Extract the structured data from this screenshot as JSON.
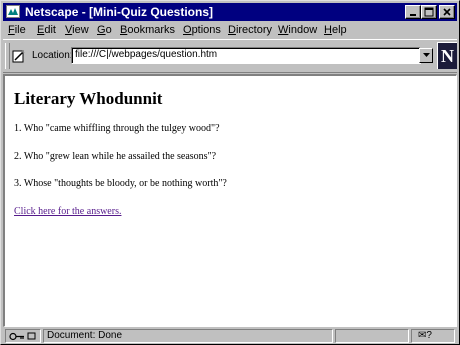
{
  "window": {
    "title": "Netscape - [Mini-Quiz Questions]"
  },
  "menu": [
    {
      "key": "F",
      "rest": "ile"
    },
    {
      "key": "E",
      "rest": "dit"
    },
    {
      "key": "V",
      "rest": "iew"
    },
    {
      "key": "G",
      "rest": "o"
    },
    {
      "key": "B",
      "rest": "ookmarks"
    },
    {
      "key": "O",
      "rest": "ptions"
    },
    {
      "key": "D",
      "rest": "irectory"
    },
    {
      "key": "W",
      "rest": "indow"
    },
    {
      "key": "H",
      "rest": "elp"
    }
  ],
  "location": {
    "label": "Location:",
    "value": "file:///C|/webpages/question.htm"
  },
  "logo": "N",
  "page": {
    "heading": "Literary Whodunnit",
    "questions": [
      "1. Who \"came whiffling through the tulgey wood\"?",
      "2. Who \"grew lean while he assailed the seasons\"?",
      "3. Whose \"thoughts be bloody, or be nothing worth\"?"
    ],
    "answers_link": "Click here for the answers."
  },
  "status": {
    "text": "Document: Done",
    "right_icons": "✉?"
  }
}
